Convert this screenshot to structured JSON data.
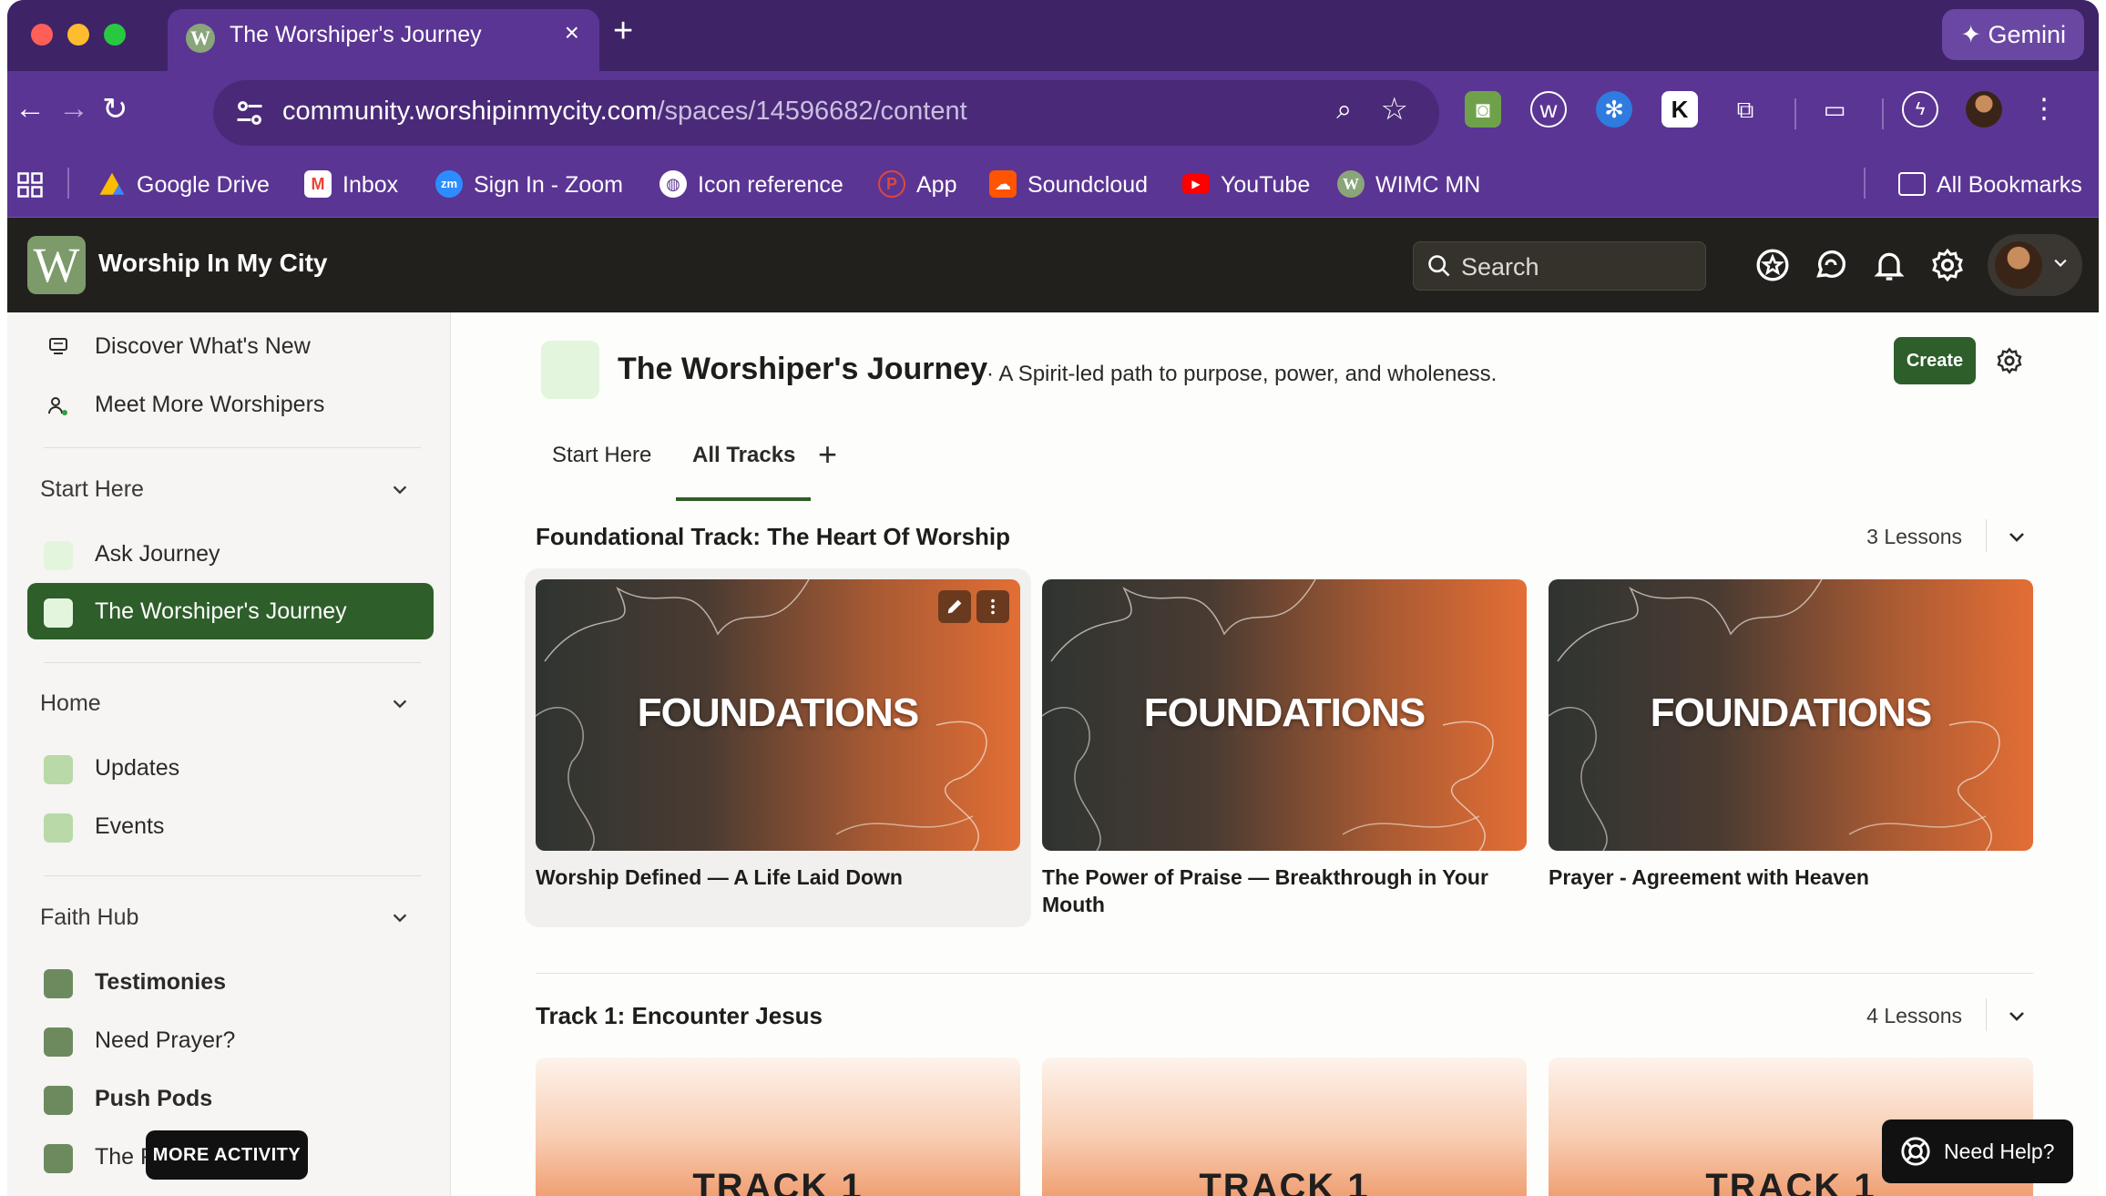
{
  "browser": {
    "tab_title": "The Worshiper's Journey",
    "tab_favicon_letter": "W",
    "tab_close": "×",
    "new_tab": "+",
    "gemini_label": "Gemini",
    "url_host": "community.worshipinmycity.com",
    "url_path": "/spaces/14596682/content",
    "bookmarks": [
      {
        "label": "Google Drive",
        "icon": "google-drive-icon",
        "color": "#34a853"
      },
      {
        "label": "Inbox",
        "icon": "gmail-icon",
        "color": "#ea4335"
      },
      {
        "label": "Sign In - Zoom",
        "icon": "zoom-icon",
        "color": "#2d8cff"
      },
      {
        "label": "Icon reference",
        "icon": "globe-icon",
        "color": "#ffffff"
      },
      {
        "label": "App",
        "icon": "app-icon",
        "color": "#e0463b"
      },
      {
        "label": "Soundcloud",
        "icon": "soundcloud-icon",
        "color": "#ff5500"
      },
      {
        "label": "YouTube",
        "icon": "youtube-icon",
        "color": "#ff0000"
      },
      {
        "label": "WIMC MN",
        "icon": "wimc-icon",
        "color": "#8aa57a"
      }
    ],
    "all_bookmarks": "All Bookmarks"
  },
  "app": {
    "logo_letter": "W",
    "community_name": "Worship In My City",
    "search_placeholder": "Search"
  },
  "sidebar": {
    "top_items": [
      {
        "label": "Discover What's New",
        "icon": "discover-icon"
      },
      {
        "label": "Meet More Worshipers",
        "icon": "people-icon"
      }
    ],
    "groups": [
      {
        "title": "Start Here",
        "items": [
          {
            "label": "Ask Journey",
            "color": "#e4f5dd",
            "active": false
          },
          {
            "label": "The Worshiper's Journey",
            "color": "#e4f5dd",
            "active": true
          }
        ]
      },
      {
        "title": "Home",
        "items": [
          {
            "label": "Updates",
            "color": "#b9d9a8"
          },
          {
            "label": "Events",
            "color": "#b9d9a8"
          }
        ]
      },
      {
        "title": "Faith Hub",
        "items": [
          {
            "label": "Testimonies",
            "color": "#6d8a5f",
            "bold": true
          },
          {
            "label": "Need Prayer?",
            "color": "#6d8a5f",
            "bold": false
          },
          {
            "label": "Push Pods",
            "color": "#6d8a5f",
            "bold": true
          },
          {
            "label": "The P",
            "color": "#6d8a5f",
            "bold": false
          }
        ]
      }
    ],
    "more_activity": "MORE ACTIVITY"
  },
  "space": {
    "title": "The Worshiper's Journey",
    "description": "· A Spirit-led path to purpose, power, and wholeness.",
    "create_label": "Create",
    "tabs": [
      {
        "label": "Start Here",
        "active": false
      },
      {
        "label": "All Tracks",
        "active": true
      }
    ],
    "add_tab": "+"
  },
  "tracks": [
    {
      "title": "Foundational Track: The Heart Of Worship",
      "count": "3 Lessons",
      "lessons": [
        {
          "thumb_text": "FOUNDATIONS",
          "title": "Worship Defined — A Life Laid Down"
        },
        {
          "thumb_text": "FOUNDATIONS",
          "title": "The Power of Praise — Breakthrough in Your Mouth"
        },
        {
          "thumb_text": "FOUNDATIONS",
          "title": "Prayer - Agreement with Heaven"
        }
      ]
    },
    {
      "title": "Track 1: Encounter Jesus",
      "count": "4 Lessons",
      "lessons": [
        {
          "thumb_text": "TRACK 1"
        },
        {
          "thumb_text": "TRACK 1"
        },
        {
          "thumb_text": "TRACK 1"
        }
      ]
    }
  ],
  "help": {
    "label": "Need Help?"
  },
  "colors": {
    "browser_chrome": "#5b3593",
    "app_header": "#22201c",
    "accent_green": "#2e5e2a",
    "thumb_orange": "#e36e35"
  }
}
